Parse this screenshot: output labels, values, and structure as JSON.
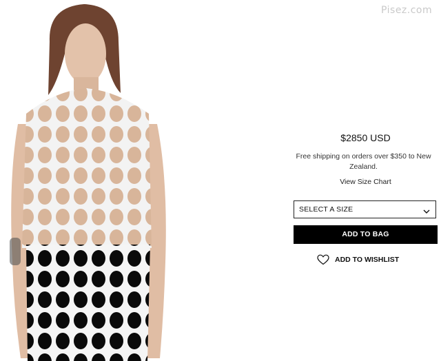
{
  "watermark": "Pisez.com",
  "product": {
    "image_alt": "Model wearing white perforated circle cut-out top",
    "price": "$2850 USD",
    "shipping_line1": "Free shipping on orders over $350 to New",
    "shipping_line2": "Zealand.",
    "size_chart_link": "View Size Chart",
    "size_select": {
      "selected": "SELECT A SIZE"
    },
    "add_to_bag": "ADD TO BAG",
    "add_to_wishlist": "ADD TO WISHLIST"
  },
  "icons": {
    "select": "chevron-down-icon",
    "wishlist": "heart-outline-icon"
  },
  "colors": {
    "button_bg": "#000000",
    "button_text": "#ffffff",
    "border": "#222222"
  }
}
